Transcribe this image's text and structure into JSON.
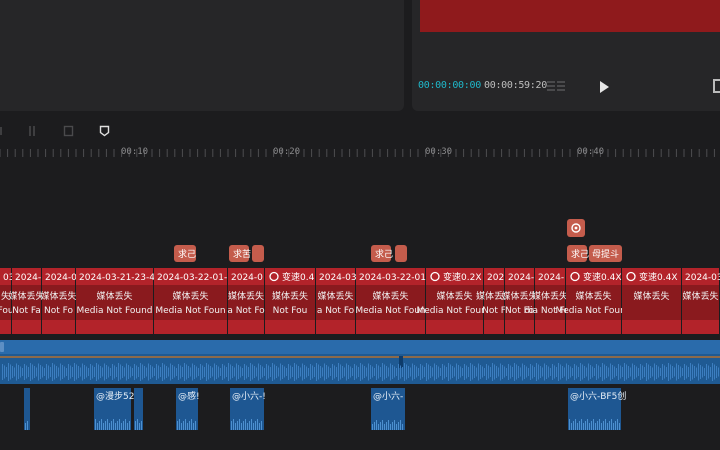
{
  "player": {
    "current_time": "00:00:00:00",
    "total_time": "00:00:59:20"
  },
  "ruler": {
    "labels": [
      "00:10",
      "00:20",
      "00:30",
      "00:40"
    ]
  },
  "clips_date": [
    "03",
    "2024-",
    "2024-0",
    "2024-03-21-23-4",
    "2024-03-22-01-",
    "2024-0",
    "变速0.4",
    "2024-03",
    "2024-03-22-01",
    "变速0.2X",
    "202",
    "2024-",
    "2024-",
    "变速0.4X",
    "变速0.4X",
    "2024-03"
  ],
  "clips_lost": [
    "失",
    "媒体丢失",
    "媒体丢失",
    "媒体丢失",
    "媒体丢失",
    "媒体丢失",
    "媒体丢失",
    "媒体丢失",
    "媒体丢失",
    "媒体丢失",
    "媒体丢失",
    "媒体丢失",
    "媒体丢失",
    "媒体丢失",
    "媒体丢失",
    "媒体丢失"
  ],
  "clips_nf": [
    "Fou",
    "Not Fa",
    "Not Fo",
    "Media Not Found",
    "Media Not Foun",
    "a Not Fo",
    "Not Fou",
    "a Not Fo",
    "Media Not Foun",
    "Media Not Found",
    "Not F",
    "Not Fo",
    "dia Not Fou",
    "Media Not Found",
    "",
    ""
  ],
  "effects": [
    "求己",
    "求苦",
    "求己",
    "求己",
    "母提斗"
  ],
  "audio_labels": [
    "@漫步52",
    "@感!",
    "@小六-!",
    "@小六-",
    "@小六-BF5创"
  ],
  "colors": {
    "accent": "#1fb7c9",
    "clip_red": "#b3232a",
    "clip_dark": "#8a1a1e",
    "effect": "#c45c4c",
    "audio_blue": "#1f5a93"
  }
}
